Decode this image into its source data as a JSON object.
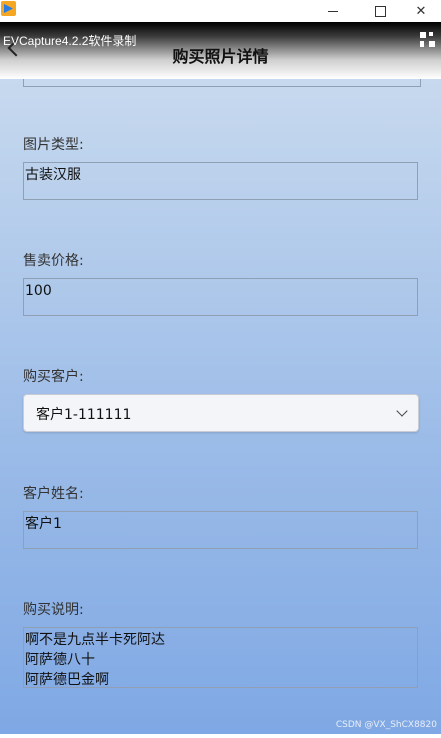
{
  "window": {
    "minimize": "—",
    "maximize": "☐",
    "close": "✕"
  },
  "recorder_watermark": "EVCapture4.2.2软件录制",
  "header": {
    "title": "购买照片详情"
  },
  "form": {
    "photo_type": {
      "label": "图片类型:",
      "value": "古装汉服"
    },
    "price": {
      "label": "售卖价格:",
      "value": "100"
    },
    "customer": {
      "label": "购买客户:",
      "selected": "客户1-111111"
    },
    "customer_name": {
      "label": "客户姓名:",
      "value": "客户1"
    },
    "description": {
      "label": "购买说明:",
      "lines": [
        "啊不是九点半卡死阿达",
        "阿萨德八十",
        "阿萨德巴金啊"
      ]
    }
  },
  "footer_watermark": "CSDN @VX_ShCX8820"
}
